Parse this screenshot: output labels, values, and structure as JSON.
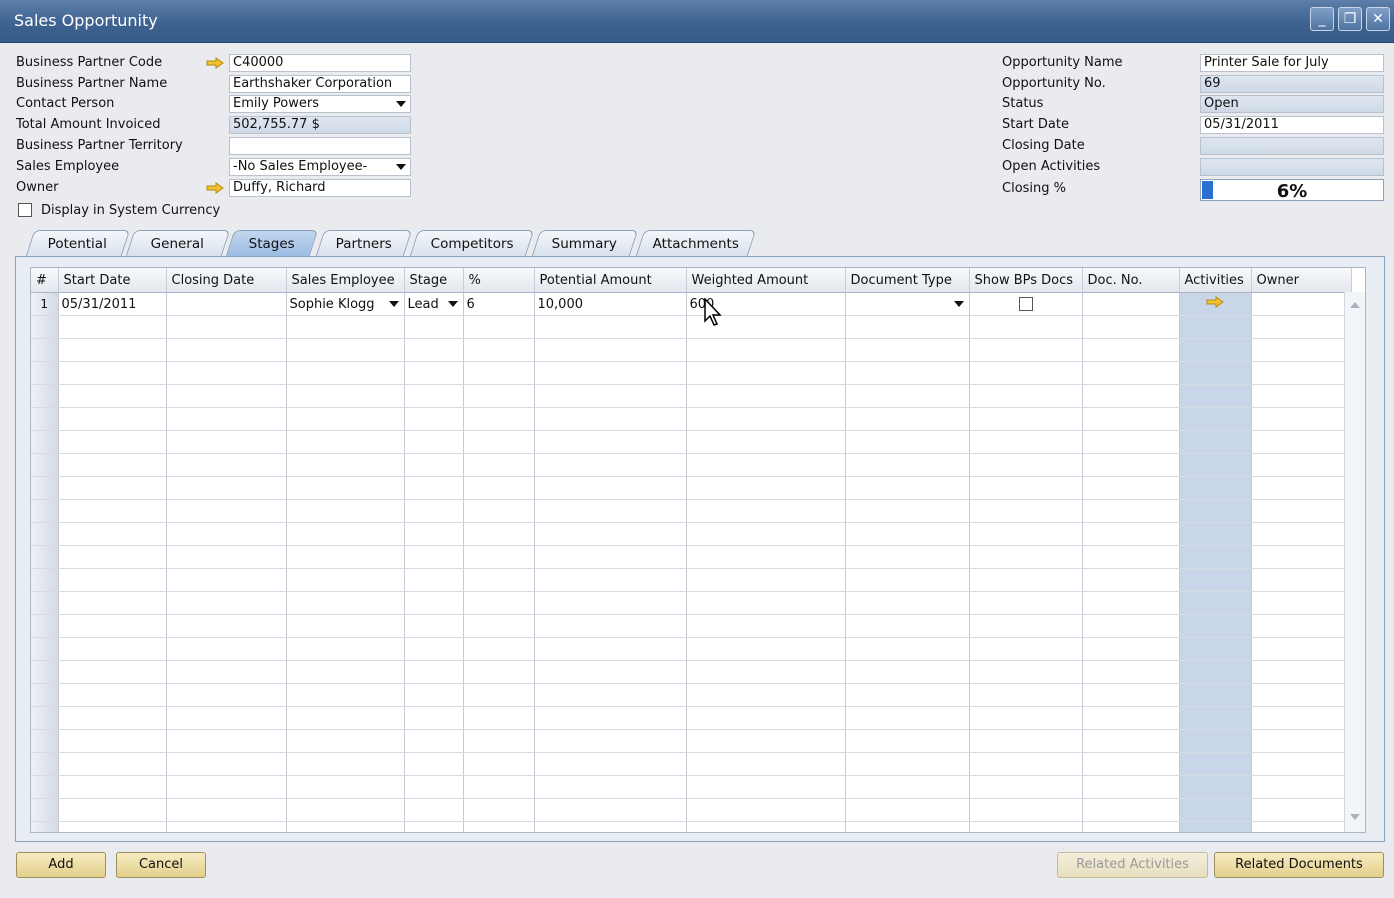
{
  "window": {
    "title": "Sales Opportunity"
  },
  "header_left": {
    "bp_code_label": "Business Partner Code",
    "bp_code": "C40000",
    "bp_name_label": "Business Partner Name",
    "bp_name": "Earthshaker Corporation",
    "contact_label": "Contact Person",
    "contact": "Emily Powers",
    "invoiced_label": "Total Amount Invoiced",
    "invoiced": "502,755.77 $",
    "territory_label": "Business Partner Territory",
    "territory": "",
    "sales_emp_label": "Sales Employee",
    "sales_emp": "-No Sales Employee-",
    "owner_label": "Owner",
    "owner": "Duffy, Richard",
    "sys_currency_label": "Display in System Currency"
  },
  "header_right": {
    "opp_name_label": "Opportunity Name",
    "opp_name": "Printer Sale for July",
    "opp_no_label": "Opportunity No.",
    "opp_no": "69",
    "status_label": "Status",
    "status": "Open",
    "start_label": "Start Date",
    "start": "05/31/2011",
    "closing_label": "Closing Date",
    "closing": "",
    "open_act_label": "Open Activities",
    "open_act": "",
    "closing_pct_label": "Closing %",
    "closing_pct": "6%",
    "closing_pct_value": 0.06
  },
  "tabs": [
    "Potential",
    "General",
    "Stages",
    "Partners",
    "Competitors",
    "Summary",
    "Attachments"
  ],
  "active_tab": "Stages",
  "grid": {
    "columns": [
      "#",
      "Start Date",
      "Closing Date",
      "Sales Employee",
      "Stage",
      "%",
      "Potential Amount",
      "Weighted Amount",
      "Document Type",
      "Show BPs Docs",
      "Doc. No.",
      "Activities",
      "Owner"
    ],
    "rows": [
      {
        "num": "1",
        "start": "05/31/2011",
        "closing": "",
        "employee": "Sophie Klogg",
        "stage": "Lead",
        "pct": "6",
        "potential": "10,000",
        "weighted": "600",
        "doctype": "",
        "docno": "",
        "owner": ""
      }
    ]
  },
  "buttons": {
    "add": "Add",
    "cancel": "Cancel",
    "related_activities": "Related Activities",
    "related_documents": "Related Documents"
  }
}
